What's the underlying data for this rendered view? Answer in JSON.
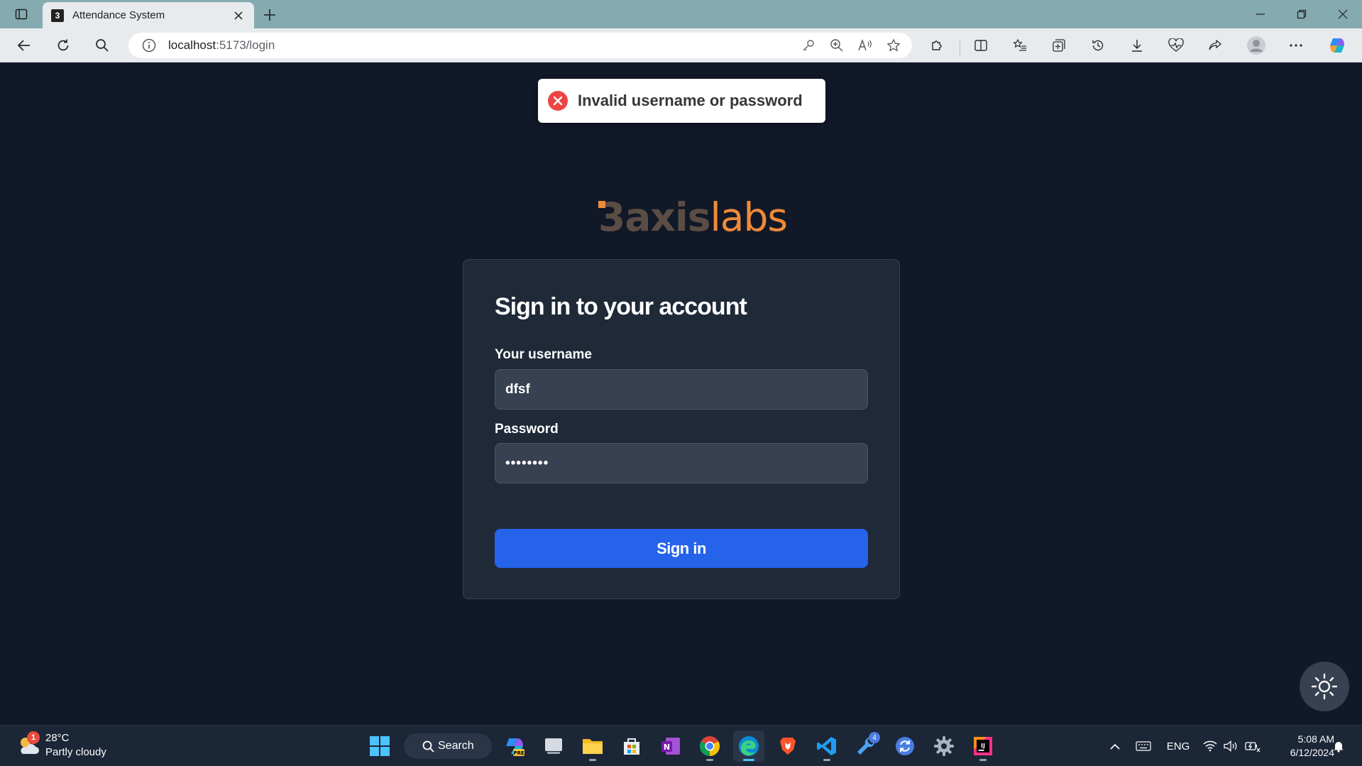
{
  "browser": {
    "tab_title": "Attendance System",
    "tab_favicon": "3",
    "url_host": "localhost",
    "url_path": ":5173/login"
  },
  "toast": {
    "message": "Invalid username or password",
    "type": "error"
  },
  "logo": {
    "part_number": "3",
    "part_axis": "axis",
    "part_labs": "labs"
  },
  "login": {
    "title": "Sign in to your account",
    "username_label": "Your username",
    "username_value": "dfsf",
    "password_label": "Password",
    "password_value": "••••••••",
    "submit_label": "Sign in"
  },
  "taskbar": {
    "weather_temp": "28°C",
    "weather_desc": "Partly cloudy",
    "weather_badge": "1",
    "search_label": "Search",
    "tray_lang": "ENG",
    "clock_time": "5:08 AM",
    "clock_date": "6/12/2024",
    "app_badge": "4"
  },
  "colors": {
    "page_bg": "#111827",
    "card_bg": "#1f2937",
    "input_bg": "#374151",
    "button": "#2563eb",
    "error": "#ef4444",
    "logo_orange": "#ee8a3a"
  }
}
